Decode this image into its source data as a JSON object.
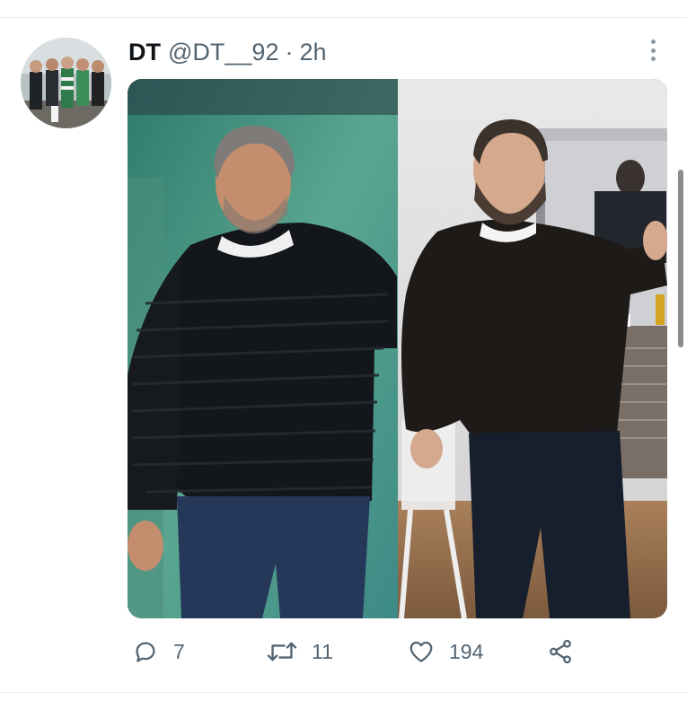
{
  "tweet": {
    "display_name": "DT",
    "handle": "@DT__92",
    "separator": "·",
    "time": "2h"
  },
  "actions": {
    "reply_count": "7",
    "retweet_count": "11",
    "like_count": "194"
  },
  "icons": {
    "reply": "comment-bubble-icon",
    "retweet": "retweet-arrows-icon",
    "like": "heart-icon",
    "share": "share-icon",
    "more": "more-vertical-icon"
  },
  "colors": {
    "text_primary": "#0f1419",
    "text_secondary": "#536471",
    "divider": "#e6ecf0"
  }
}
